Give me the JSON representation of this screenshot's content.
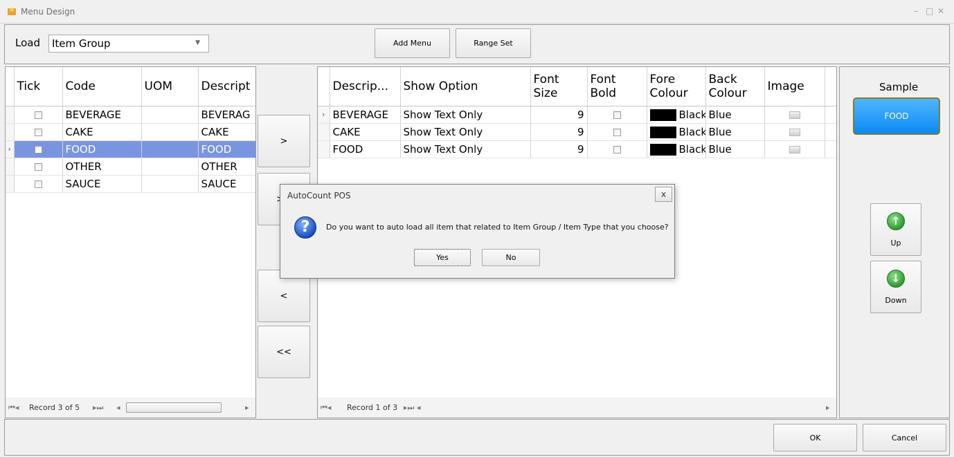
{
  "window": {
    "title": "Menu Design",
    "controls": [
      "–",
      "□",
      "✕"
    ]
  },
  "load": {
    "label": "Load",
    "value": "Item Group"
  },
  "toolbar": {
    "add_menu": "Add Menu",
    "range_set": "Range Set"
  },
  "left_grid": {
    "headers": [
      "Tick",
      "Code",
      "UOM",
      "Descript"
    ],
    "rows": [
      {
        "code": "BEVERAGE",
        "uom": "",
        "desc": "BEVERAG"
      },
      {
        "code": "CAKE",
        "uom": "",
        "desc": "CAKE"
      },
      {
        "code": "FOOD",
        "uom": "",
        "desc": "FOOD"
      },
      {
        "code": "OTHER",
        "uom": "",
        "desc": "OTHER"
      },
      {
        "code": "SAUCE",
        "uom": "",
        "desc": "SAUCE"
      }
    ],
    "selected_row": 3,
    "record": "Record 3 of 5"
  },
  "mid_buttons": {
    "add_one": ">",
    "add_all": ">>",
    "remove_one": "<",
    "remove_all": "<<"
  },
  "right_grid": {
    "headers": {
      "desc": "Descrip...",
      "show": "Show Option",
      "size1": "Font",
      "size2": "Size",
      "bold1": "Font",
      "bold2": "Bold",
      "fore1": "Fore",
      "fore2": "Colour",
      "back1": "Back",
      "back2": "Colour",
      "image": "Image"
    },
    "rows": [
      {
        "desc": "BEVERAGE",
        "show": "Show Text Only",
        "size": "9",
        "fore": "Black",
        "back": "Blue"
      },
      {
        "desc": "CAKE",
        "show": "Show Text Only",
        "size": "9",
        "fore": "Black",
        "back": "Blue"
      },
      {
        "desc": "FOOD",
        "show": "Show Text Only",
        "size": "9",
        "fore": "Black",
        "back": "Blue"
      }
    ],
    "record": "Record 1 of 3"
  },
  "sample": {
    "label": "Sample",
    "button": "FOOD"
  },
  "order": {
    "up": "Up",
    "down": "Down"
  },
  "footer": {
    "ok": "OK",
    "cancel": "Cancel"
  },
  "dialog": {
    "title": "AutoCount POS",
    "message": "Do you want to auto load all item that related to Item Group / Item Type that you choose?",
    "yes": "Yes",
    "no": "No",
    "close": "x"
  },
  "colors": {
    "selected_row": "#7a95e0",
    "sample_button": "#0a8af4"
  }
}
